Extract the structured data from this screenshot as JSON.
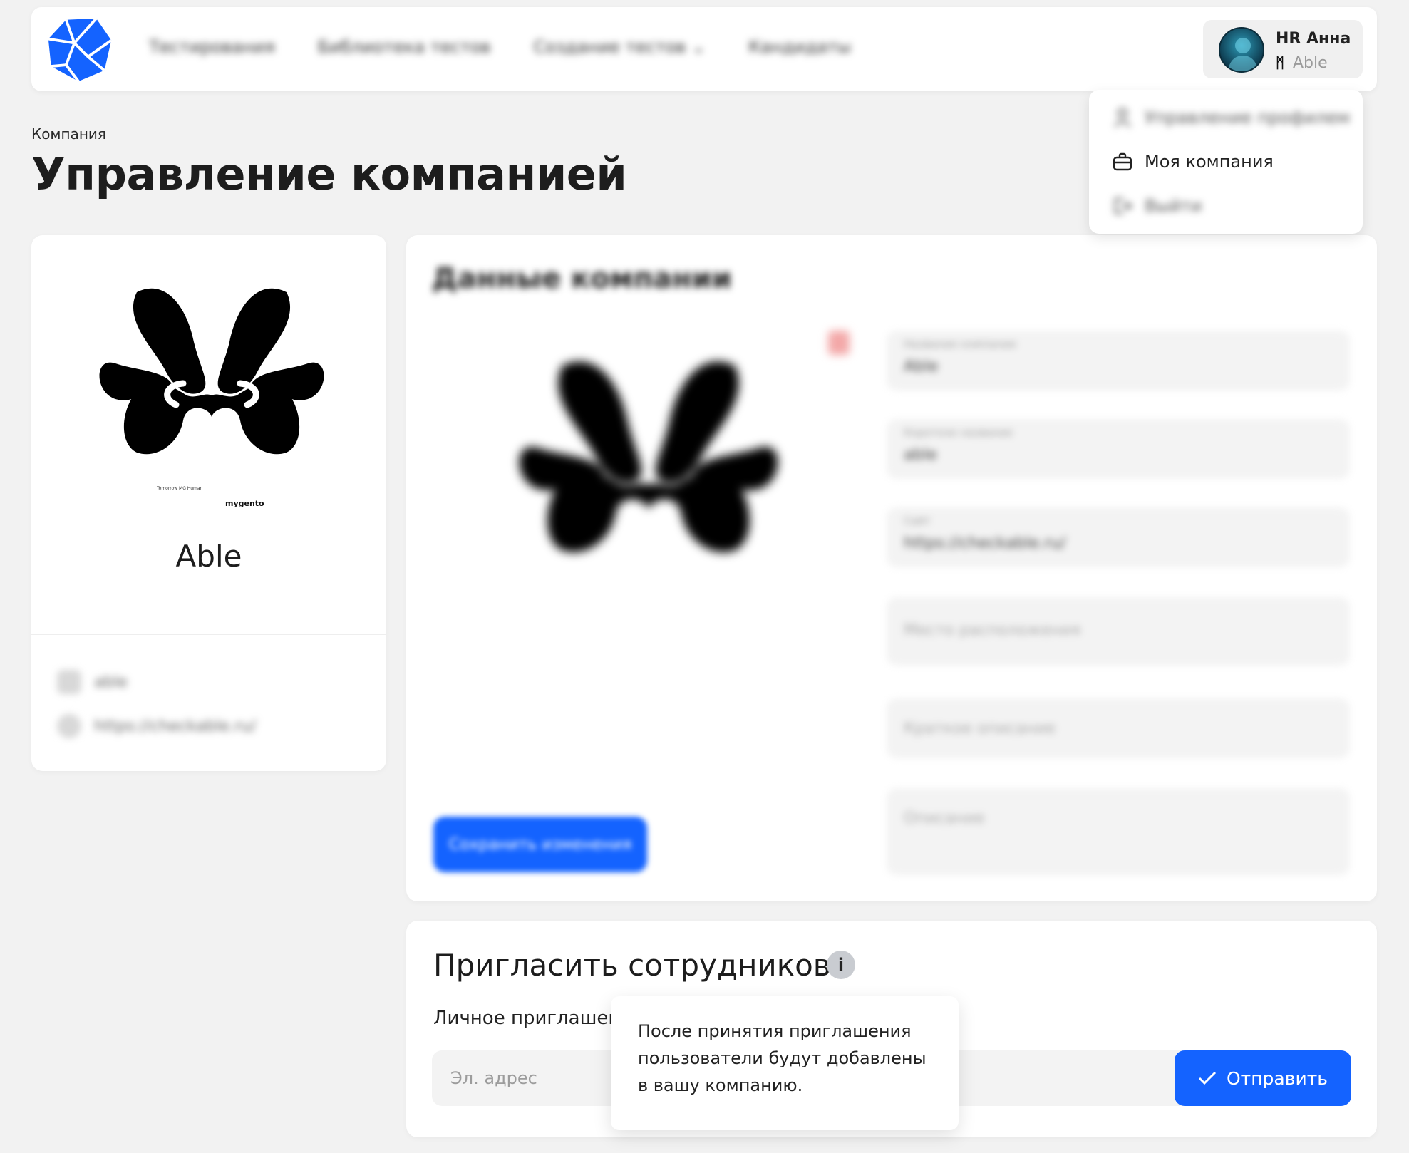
{
  "header": {
    "nav": [
      {
        "label": "Тестирования"
      },
      {
        "label": "Библиотека тестов"
      },
      {
        "label": "Создание тестов"
      },
      {
        "label": "Кандидаты"
      }
    ],
    "user": {
      "name": "HR Анна",
      "company": "Able"
    }
  },
  "user_menu": {
    "items": [
      {
        "label": "Управление профилем",
        "icon": "user-icon"
      },
      {
        "label": "Моя компания",
        "icon": "briefcase-icon"
      },
      {
        "label": "Выйти",
        "icon": "logout-icon"
      }
    ]
  },
  "page": {
    "breadcrumb": "Компания",
    "title": "Управление компанией"
  },
  "company_card": {
    "name": "Able",
    "logo_caption": "Tomorrow MG Human",
    "logo_brand": "mygento",
    "meta": [
      {
        "text": "able",
        "icon": "building-icon"
      },
      {
        "text": "https://checkable.ru/",
        "icon": "globe-icon"
      }
    ]
  },
  "company_data": {
    "title": "Данные компании",
    "save_label": "Сохранить изменения",
    "fields": [
      {
        "label": "Название компании",
        "value": "Able"
      },
      {
        "label": "Короткое название",
        "value": "able"
      },
      {
        "label": "Сайт",
        "value": "https://checkable.ru/"
      },
      {
        "placeholder": "Место расположения"
      },
      {
        "placeholder": "Краткое описание"
      },
      {
        "placeholder": "Описание"
      }
    ]
  },
  "invite": {
    "title": "Пригласить сотрудников",
    "personal_label": "Личное приглашен",
    "email_placeholder": "Эл. адрес",
    "send_label": "Отправить",
    "tooltip": "После принятия приглашения пользователи будут добавлены в вашу компанию."
  },
  "colors": {
    "accent": "#1463ff",
    "background": "#f2f2f2",
    "card": "#ffffff"
  }
}
